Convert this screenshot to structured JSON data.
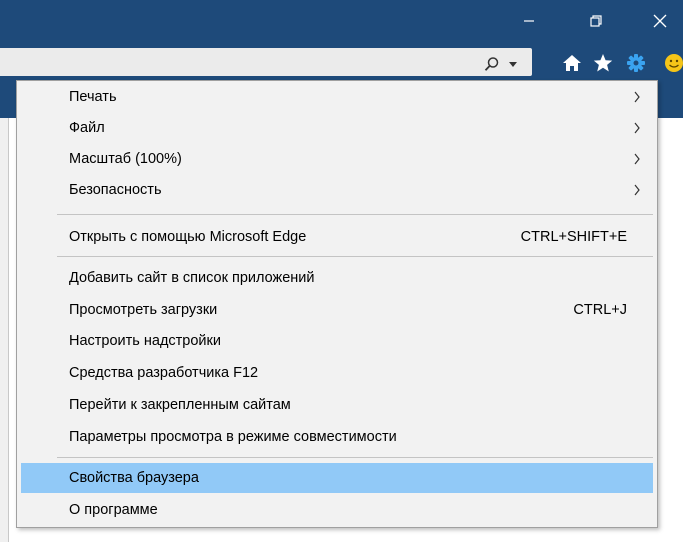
{
  "window": {
    "minimize_icon": "minimize-icon",
    "restore_icon": "restore-icon",
    "close_icon": "close-icon"
  },
  "toolbar": {
    "search_icon": "search-icon",
    "dropdown_icon": "chevron-down-icon",
    "home_icon": "home-icon",
    "favorites_icon": "star-icon",
    "tools_icon": "gear-icon",
    "feedback_icon": "smiley-icon"
  },
  "menu": {
    "print": "Печать",
    "file": "Файл",
    "zoom": "Масштаб (100%)",
    "safety": "Безопасность",
    "open_edge": "Открыть с помощью Microsoft Edge",
    "open_edge_shortcut": "CTRL+SHIFT+E",
    "add_site": "Добавить сайт в список приложений",
    "downloads": "Просмотреть загрузки",
    "downloads_shortcut": "CTRL+J",
    "addons": "Настроить надстройки",
    "devtools": "Средства разработчика F12",
    "pinned": "Перейти к закрепленным сайтам",
    "compat": "Параметры просмотра в режиме совместимости",
    "options": "Свойства браузера",
    "about": "О программе"
  },
  "colors": {
    "chrome": "#1e4a7a",
    "highlight": "#91c9f7",
    "menu_bg": "#f2f2f2"
  }
}
